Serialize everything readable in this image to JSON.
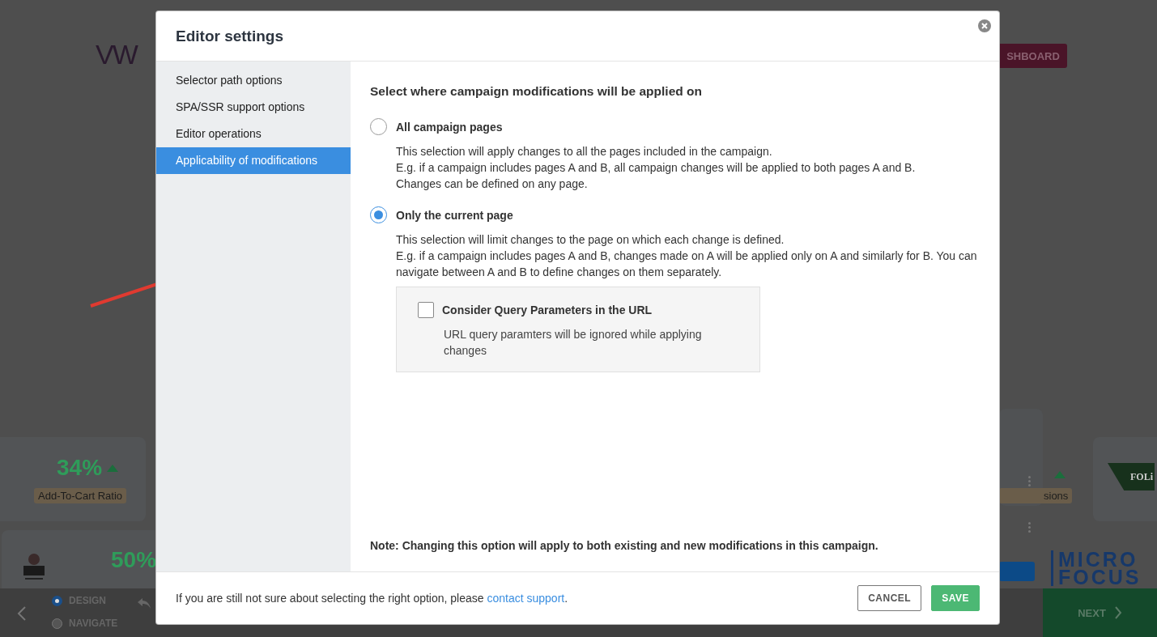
{
  "background": {
    "logo": "VW",
    "dashboard_button": "SHBOARD",
    "metrics": [
      {
        "value": "34%",
        "label": "Add-To-Cart Ratio"
      },
      {
        "value": "50%"
      }
    ],
    "partial_label": "sions",
    "brand": "FOLi",
    "brand_2": "MICRO FOCUS",
    "modes": [
      {
        "label": "DESIGN",
        "selected": true
      },
      {
        "label": "NAVIGATE",
        "selected": false
      }
    ],
    "next_button": "NEXT"
  },
  "dialog": {
    "title": "Editor settings",
    "sidebar": [
      {
        "label": "Selector path options",
        "selected": false
      },
      {
        "label": "SPA/SSR support options",
        "selected": false
      },
      {
        "label": "Editor operations",
        "selected": false
      },
      {
        "label": "Applicability of modifications",
        "selected": true
      }
    ],
    "heading": "Select where campaign modifications will be applied on",
    "options": [
      {
        "label": "All campaign pages",
        "selected": false,
        "description": [
          "This selection will apply changes to all the pages included in the campaign.",
          "E.g. if a campaign includes pages A and B, all campaign changes will be applied to both pages A and B.",
          "Changes can be defined on any page."
        ]
      },
      {
        "label": "Only the current page",
        "selected": true,
        "description": [
          "This selection will limit changes to the page on which each change is defined.",
          "E.g. if a campaign includes pages A and B, changes made on A will be applied only on A and similarly for B. You can navigate between A and B to define changes on them separately."
        ],
        "sub_option": {
          "label": "Consider Query Parameters in the URL",
          "checked": false,
          "description": "URL query paramters will be ignored while applying changes"
        }
      }
    ],
    "note": "Note: Changing this option will apply to both existing and new modifications in this campaign.",
    "footer": {
      "text": "If you are still not sure about selecting the right option, please ",
      "link": "contact support",
      "suffix": "."
    },
    "buttons": [
      {
        "label": "CANCEL",
        "kind": "secondary"
      },
      {
        "label": "SAVE",
        "kind": "primary"
      }
    ]
  }
}
